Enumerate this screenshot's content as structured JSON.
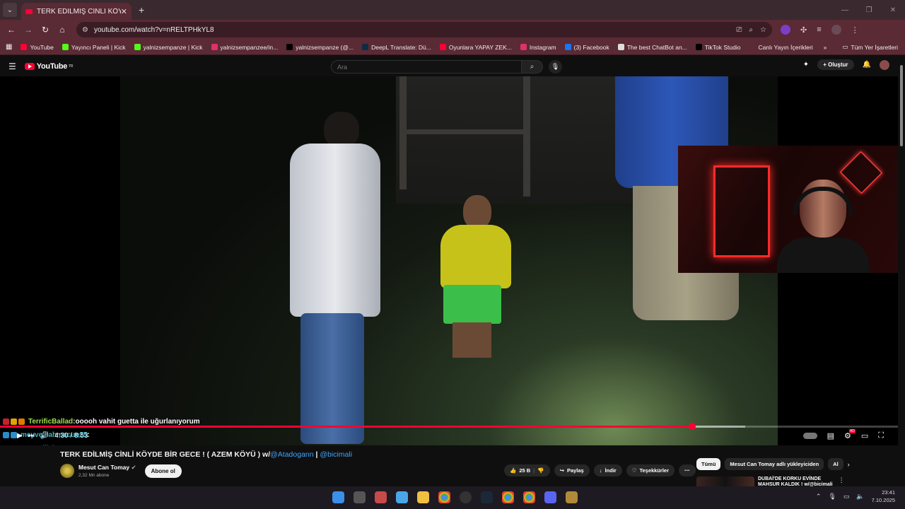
{
  "browser": {
    "tab_title": "TERK EDİLMİŞ CİNLİ KÖYDE BİR",
    "tab_close": "✕",
    "new_tab": "+",
    "url": "youtube.com/watch?v=nRELTPHkYL8",
    "bookmarks": [
      {
        "label": "YouTube",
        "color": "#ff0033"
      },
      {
        "label": "Yayıncı Paneli | Kick",
        "color": "#53fc18"
      },
      {
        "label": "yalnizsempanze | Kick",
        "color": "#53fc18"
      },
      {
        "label": "yalnizsempanzee/in...",
        "color": "#e1306c"
      },
      {
        "label": "yalnizsempanze (@...",
        "color": "#000000"
      },
      {
        "label": "DeepL Translate: Dü...",
        "color": "#0f2b46"
      },
      {
        "label": "Oyunlara YAPAY ZEK...",
        "color": "#ff0033"
      },
      {
        "label": "Instagram",
        "color": "#e1306c"
      },
      {
        "label": "(3) Facebook",
        "color": "#1877f2"
      },
      {
        "label": "The best ChatBot an...",
        "color": "#dddddd"
      },
      {
        "label": "TikTok Studio",
        "color": "#000000"
      },
      {
        "label": "Canlı Yayın İçerikleri",
        "color": "#5a2a35"
      }
    ],
    "bookmarks_more": "»",
    "all_bookmarks": "Tüm Yer İşaretleri"
  },
  "youtube": {
    "logo": "YouTube",
    "logo_region": "TR",
    "search_placeholder": "Ara",
    "create_label": "Oluştur"
  },
  "player": {
    "current_time": "4:30",
    "duration": "8:53",
    "time_separator": "/",
    "played_fraction": 0.7708,
    "buffered_fraction": 0.8299
  },
  "chat": [
    {
      "user": "TerrificBallad",
      "user_color": "#9fe34b",
      "separator": " : ",
      "message": "ooooh vahit guetta ile uğurlanıyorum"
    },
    {
      "user": "meyvelilahmacun25",
      "user_color": "#36b6c8",
      "separator": " : ",
      "message": ""
    },
    {
      "user": "meyvelilahmacun25",
      "user_color": "#36b6c8",
      "separator": " : ",
      "message": ""
    }
  ],
  "video": {
    "title_text": "TERK EDİLMİŞ CİNLİ KÖYDE BİR GECE ! ( AZEM KÖYÜ ) w/",
    "mention1": "@Atadogann",
    "title_sep": " | ",
    "mention2": "@bicimali",
    "channel": "Mesut Can Tomay",
    "subscribers": "2,32 Mn abone",
    "subscribe_label": "Abone ol",
    "likes": "25 B",
    "share_label": "Paylaş",
    "download_label": "İndir",
    "thanks_label": "Teşekkürler",
    "more_label": "⋯"
  },
  "chips": [
    "Tümü",
    "Mesut Can Tomay adlı yükleyiciden",
    "Al"
  ],
  "recommendation": {
    "title_line1": "DUBAİ'DE KORKU EVİNDE",
    "title_line2": "MAHSUR KALDIK ! w/@bicimali"
  },
  "clock": {
    "time": "23:41",
    "date": "7.10.2025"
  }
}
